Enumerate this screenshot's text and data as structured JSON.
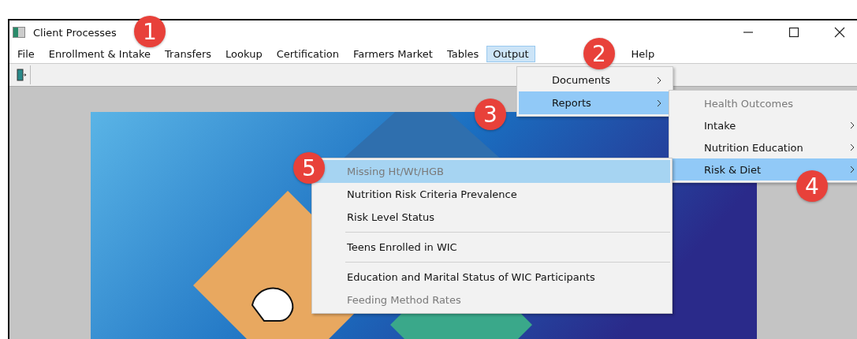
{
  "window": {
    "title": "Client Processes"
  },
  "menu_bar": [
    {
      "label": "File",
      "selected": false
    },
    {
      "label": "Enrollment & Intake",
      "selected": false
    },
    {
      "label": "Transfers",
      "selected": false
    },
    {
      "label": "Lookup",
      "selected": false
    },
    {
      "label": "Certification",
      "selected": false
    },
    {
      "label": "Farmers Market",
      "selected": false
    },
    {
      "label": "Tables",
      "selected": false
    },
    {
      "label": "Output",
      "selected": true
    },
    {
      "label": "Help",
      "selected": false
    }
  ],
  "output_menu": [
    {
      "label": "Documents",
      "selected": false,
      "disabled": false,
      "submenu": true
    },
    {
      "label": "Reports",
      "selected": true,
      "disabled": false,
      "submenu": true
    }
  ],
  "reports_menu": [
    {
      "label": "Health Outcomes",
      "selected": false,
      "disabled": true,
      "submenu": false
    },
    {
      "label": "Intake",
      "selected": false,
      "disabled": false,
      "submenu": true
    },
    {
      "label": "Nutrition Education",
      "selected": false,
      "disabled": false,
      "submenu": true
    },
    {
      "label": "Risk & Diet",
      "selected": true,
      "disabled": false,
      "submenu": true
    }
  ],
  "risk_diet_menu": [
    {
      "kind": "item",
      "label": "Missing Ht/Wt/HGB",
      "selected": true,
      "disabled": true
    },
    {
      "kind": "item",
      "label": "Nutrition Risk Criteria Prevalence",
      "selected": false,
      "disabled": false
    },
    {
      "kind": "item",
      "label": "Risk Level Status",
      "selected": false,
      "disabled": false
    },
    {
      "kind": "separator"
    },
    {
      "kind": "item",
      "label": "Teens Enrolled in WIC",
      "selected": false,
      "disabled": false
    },
    {
      "kind": "separator"
    },
    {
      "kind": "item",
      "label": "Education and Marital Status of WIC Participants",
      "selected": false,
      "disabled": false
    },
    {
      "kind": "item",
      "label": "Feeding Method Rates",
      "selected": false,
      "disabled": true
    }
  ],
  "callouts": [
    "1",
    "2",
    "3",
    "4",
    "5"
  ]
}
